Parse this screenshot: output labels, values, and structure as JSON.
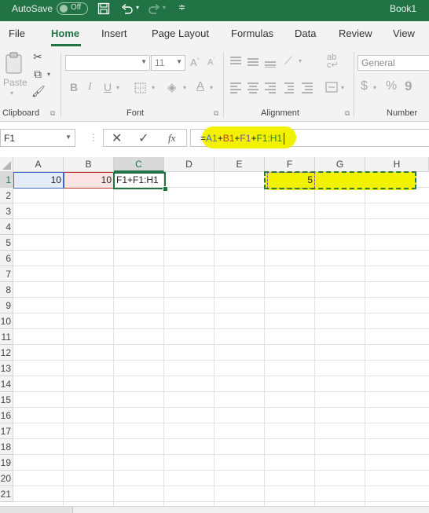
{
  "titlebar": {
    "autosave_label": "AutoSave",
    "autosave_state": "Off",
    "document_name": "Book1"
  },
  "tabs": [
    {
      "label": "File"
    },
    {
      "label": "Home"
    },
    {
      "label": "Insert"
    },
    {
      "label": "Page Layout"
    },
    {
      "label": "Formulas"
    },
    {
      "label": "Data"
    },
    {
      "label": "Review"
    },
    {
      "label": "View"
    }
  ],
  "ribbon": {
    "groups": {
      "clipboard": "Clipboard",
      "font": "Font",
      "alignment": "Alignment",
      "number": "Number"
    },
    "paste_label": "Paste",
    "font_name": "",
    "font_size": "11",
    "number_format": "General",
    "bold": "B",
    "italic": "I",
    "underline": "U",
    "grow_font": "A",
    "shrink_font": "A"
  },
  "formula_bar": {
    "name_box": "F1",
    "fx": "fx",
    "formula_parts": [
      {
        "text": "=",
        "color": "#222222"
      },
      {
        "text": "A1",
        "color": "#3c6cc8"
      },
      {
        "text": "+",
        "color": "#222222"
      },
      {
        "text": "B1",
        "color": "#c0392b"
      },
      {
        "text": "+",
        "color": "#222222"
      },
      {
        "text": "F1",
        "color": "#7a4db3"
      },
      {
        "text": "+",
        "color": "#222222"
      },
      {
        "text": "F1:H1",
        "color": "#2e7d32"
      }
    ]
  },
  "grid": {
    "columns": [
      "A",
      "B",
      "C",
      "D",
      "E",
      "F",
      "G",
      "H"
    ],
    "rows": [
      "1",
      "2",
      "3",
      "4",
      "5",
      "6",
      "7",
      "8",
      "9",
      "10",
      "11",
      "12",
      "13",
      "14",
      "15",
      "16",
      "17",
      "18",
      "19",
      "20",
      "21"
    ],
    "cells": {
      "A1": "10",
      "B1": "10",
      "C1": "F1+F1:H1",
      "F1": "5"
    },
    "selected_column": "C",
    "selected_row": "1"
  },
  "colors": {
    "excel_green": "#217346",
    "highlight_yellow": "#f2f200",
    "ref_blue": "#3c6cc8",
    "ref_red": "#c0392b"
  }
}
